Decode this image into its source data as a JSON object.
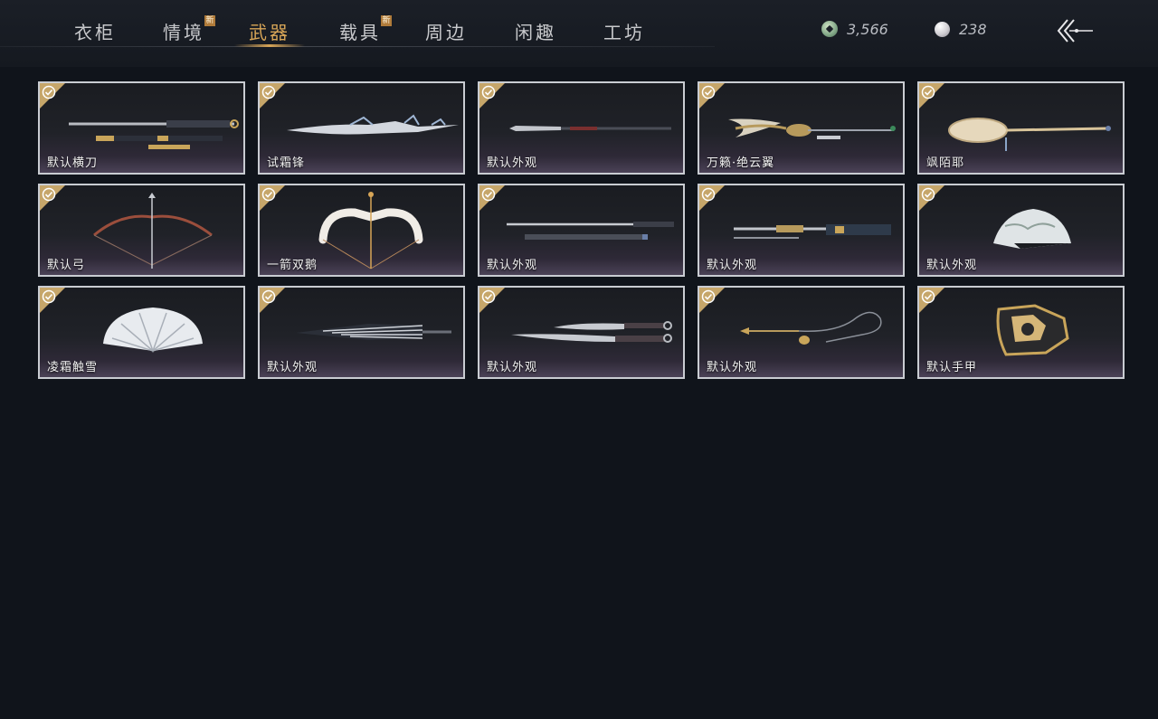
{
  "tabs": [
    {
      "label": "衣柜",
      "badge": ""
    },
    {
      "label": "情境",
      "badge": "新"
    },
    {
      "label": "武器",
      "badge": ""
    },
    {
      "label": "载具",
      "badge": "新"
    },
    {
      "label": "周边",
      "badge": ""
    },
    {
      "label": "闲趣",
      "badge": ""
    },
    {
      "label": "工坊",
      "badge": ""
    }
  ],
  "active_tab": "武器",
  "currency": {
    "coins": "3,566",
    "pearls": "238"
  },
  "colors": {
    "accent": "#d7a557",
    "badge": "#b07b3a",
    "check_corner": "#c6a66a",
    "card_border": "#c9ccd2",
    "background": "#10141b"
  },
  "items": [
    {
      "label": "默认横刀",
      "icon": "sabre-icon",
      "owned": true
    },
    {
      "label": "试霜锋",
      "icon": "frost-blade-icon",
      "owned": true
    },
    {
      "label": "默认外观",
      "icon": "spear-icon",
      "owned": true
    },
    {
      "label": "万籁·绝云翼",
      "icon": "winged-spear-icon",
      "owned": true
    },
    {
      "label": "飒陌耶",
      "icon": "racket-staff-icon",
      "owned": true
    },
    {
      "label": "默认弓",
      "icon": "bow-icon",
      "owned": true
    },
    {
      "label": "一箭双鹅",
      "icon": "white-bow-icon",
      "owned": true
    },
    {
      "label": "默认外观",
      "icon": "twin-swords-icon",
      "owned": true
    },
    {
      "label": "默认外观",
      "icon": "long-sword-icon",
      "owned": true
    },
    {
      "label": "默认外观",
      "icon": "folding-fan-icon",
      "owned": true
    },
    {
      "label": "凌霜触雪",
      "icon": "lace-fan-icon",
      "owned": true
    },
    {
      "label": "默认外观",
      "icon": "umbrella-icon",
      "owned": true
    },
    {
      "label": "默认外观",
      "icon": "dual-dao-icon",
      "owned": true
    },
    {
      "label": "默认外观",
      "icon": "rope-dart-icon",
      "owned": true
    },
    {
      "label": "默认手甲",
      "icon": "gauntlet-icon",
      "owned": true
    }
  ]
}
